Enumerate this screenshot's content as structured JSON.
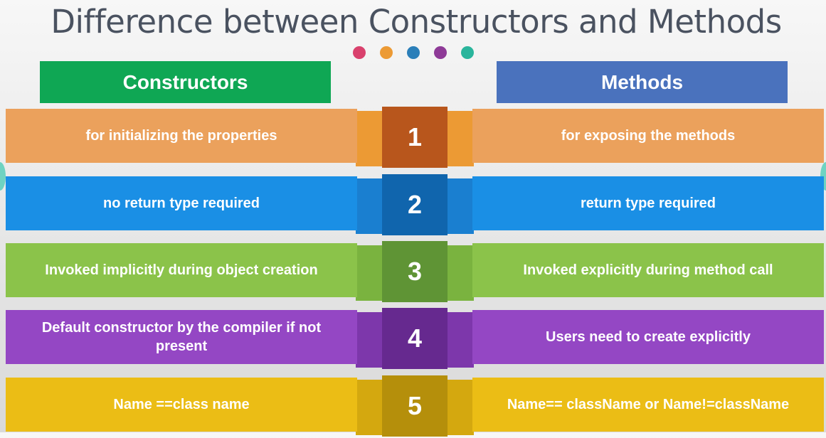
{
  "title": "Difference between Constructors and Methods",
  "dot_colors": [
    "#d9416d",
    "#ec9a34",
    "#2b7fb9",
    "#8e3a97",
    "#2ab59c"
  ],
  "headers": {
    "left": {
      "label": "Constructors",
      "color": "#0fa754"
    },
    "right": {
      "label": "Methods",
      "color": "#4a72bd"
    }
  },
  "rows": [
    {
      "number": "1",
      "left": "for initializing the properties",
      "right": "for exposing the methods",
      "color": "#eba15c",
      "dark": "#b8561c",
      "mid": "#ec9a34"
    },
    {
      "number": "2",
      "left": "no return type required",
      "right": "return type required",
      "color": "#1a8fe5",
      "dark": "#1065ad",
      "mid": "#1a7fd0"
    },
    {
      "number": "3",
      "left": "Invoked implicitly during object creation",
      "right": "Invoked explicitly during method call",
      "color": "#8bc34a",
      "dark": "#5f9435",
      "mid": "#7ab33f"
    },
    {
      "number": "4",
      "left": "Default constructor by the compiler if not present",
      "right": "Users need to create explicitly",
      "color": "#9447c4",
      "dark": "#66298f",
      "mid": "#7d37ab"
    },
    {
      "number": "5",
      "left": "Name ==class name",
      "right": "Name== className or Name!=className",
      "color": "#ebbd15",
      "dark": "#b58f0b",
      "mid": "#d4a80f"
    }
  ]
}
